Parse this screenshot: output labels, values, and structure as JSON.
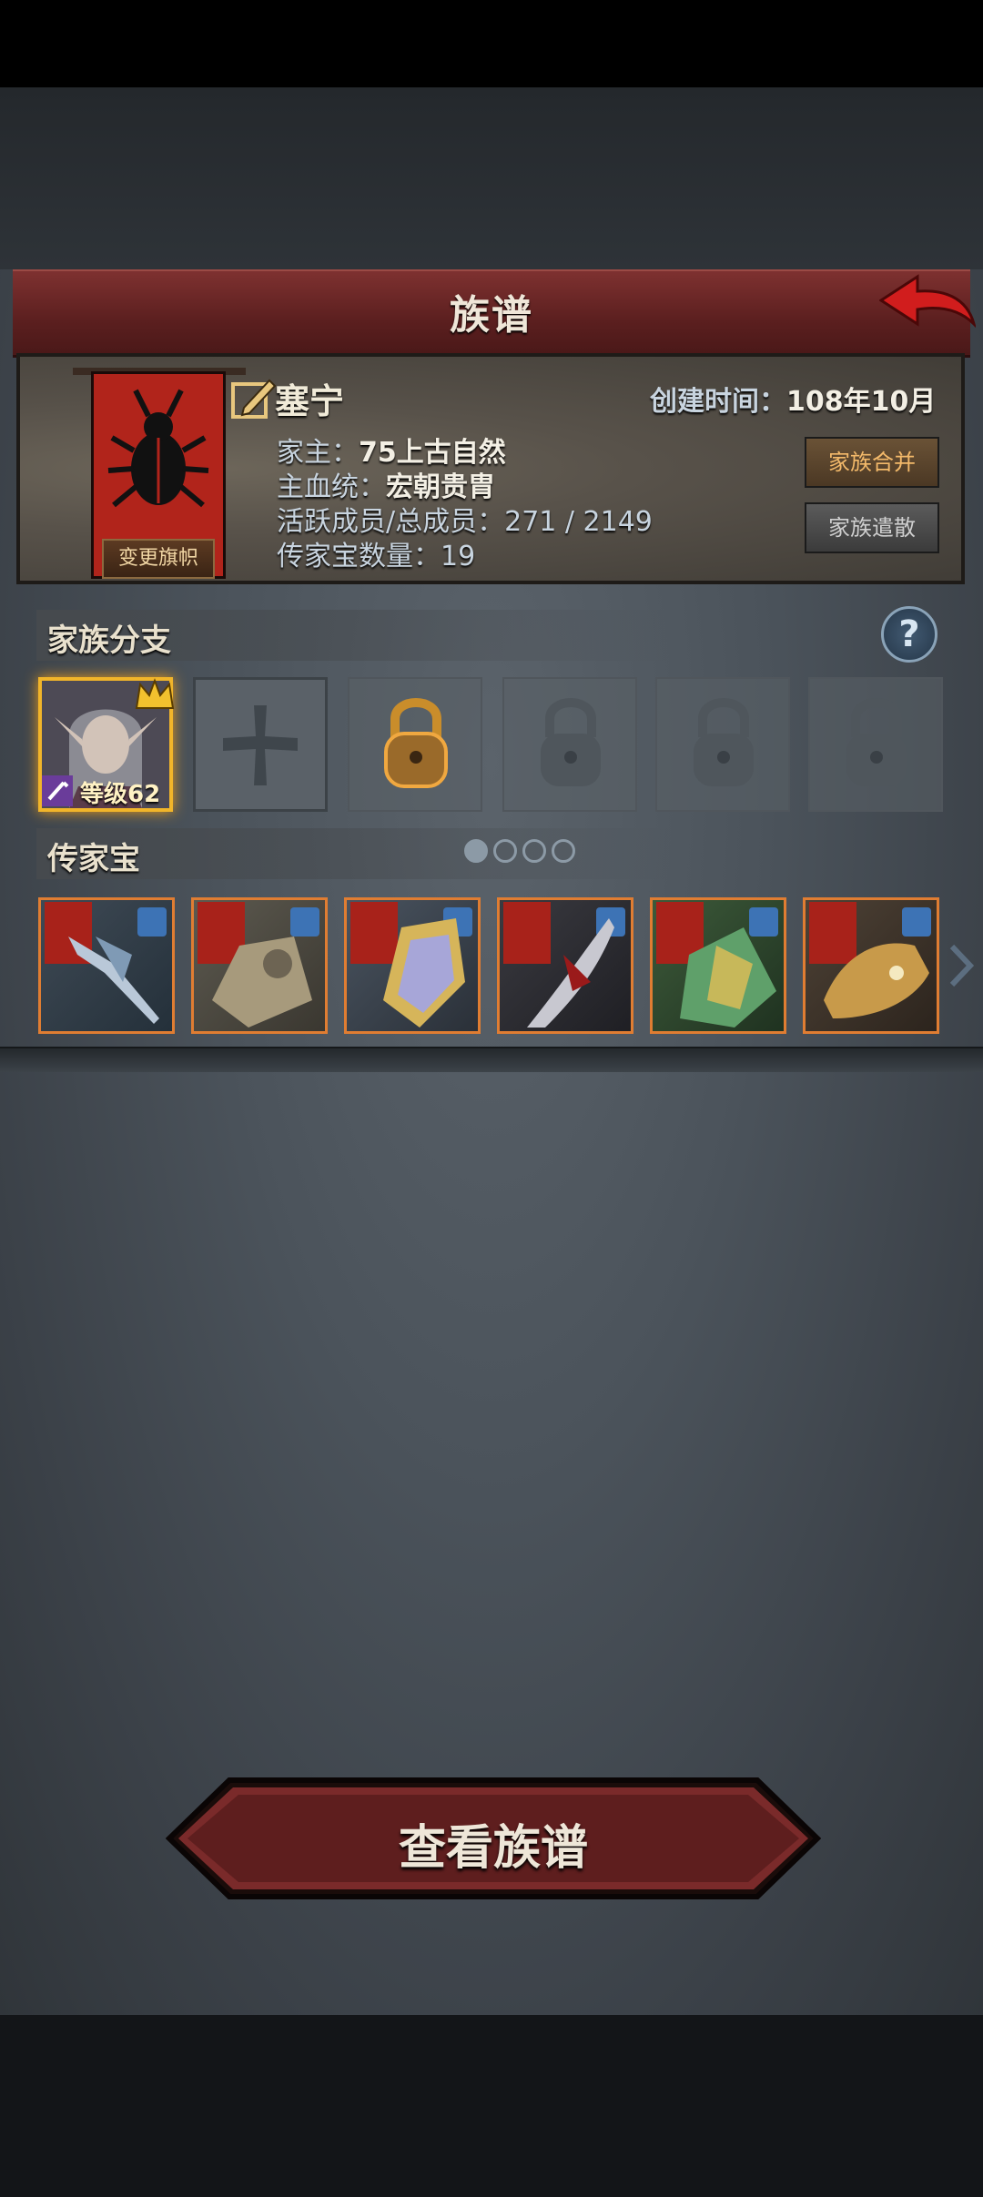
{
  "header": {
    "title": "族谱"
  },
  "family": {
    "name": "塞宁",
    "created_label": "创建时间：",
    "created_value": "108年10月",
    "change_banner_label": "变更旗帜",
    "leader_label": "家主：",
    "leader_value": "75上古自然",
    "bloodline_label": "主血统：",
    "bloodline_value": "宏朝贵胄",
    "members_label": "活跃成员/总成员：",
    "members_value": "271 / 2149",
    "heirloom_count_label": "传家宝数量：",
    "heirloom_count_value": "19",
    "merge_button": "家族合并",
    "disband_button": "家族遣散"
  },
  "branches": {
    "title": "家族分支",
    "help_label": "?",
    "active_member_level": "等级62"
  },
  "heirlooms": {
    "title": "传家宝",
    "page_count": 4,
    "active_page": 1,
    "items": [
      {
        "icon": "halberd-icon"
      },
      {
        "icon": "armor-icon"
      },
      {
        "icon": "shield-icon"
      },
      {
        "icon": "blade-icon"
      },
      {
        "icon": "green-armor-icon"
      },
      {
        "icon": "dragon-helm-icon"
      }
    ]
  },
  "footer": {
    "view_button": "查看族谱"
  },
  "colors": {
    "accent": "#b1241b",
    "gold": "#f1b52a",
    "item_border": "#e07d32"
  }
}
